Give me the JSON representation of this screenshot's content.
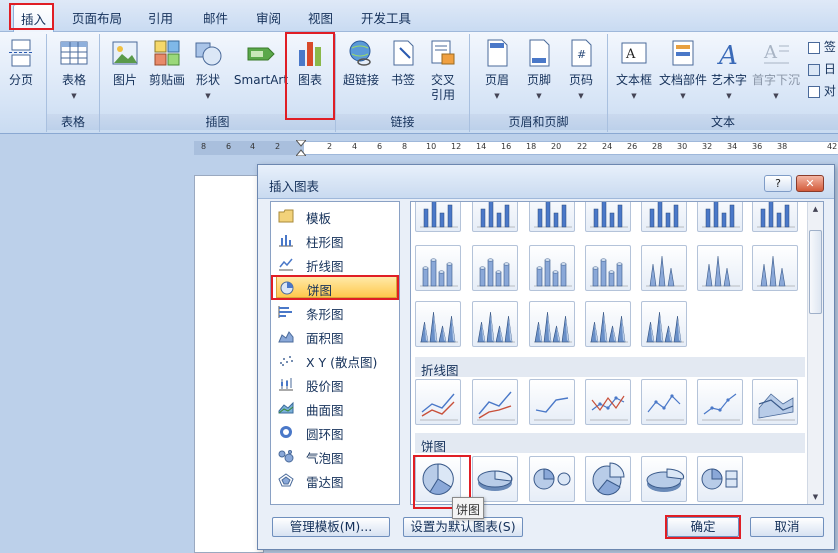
{
  "ribbon": {
    "tabs": [
      "插入",
      "页面布局",
      "引用",
      "邮件",
      "审阅",
      "视图",
      "开发工具"
    ],
    "buttons": {
      "pagebreak": "分页",
      "table": "表格",
      "picture": "图片",
      "clipart": "剪贴画",
      "shapes": "形状",
      "smartart": "SmartArt",
      "chart": "图表",
      "hyperlink": "超链接",
      "bookmark": "书签",
      "crossref_1": "交叉",
      "crossref_2": "引用",
      "header": "页眉",
      "footer": "页脚",
      "pagenumber": "页码",
      "textbox": "文本框",
      "quickparts": "文档部件",
      "wordart": "艺术字",
      "dropcap": "首字下沉",
      "signature": "签",
      "datetime": "日",
      "object": "对"
    },
    "groups": {
      "tables": "表格",
      "illustrations": "插图",
      "links": "链接",
      "header_footer": "页眉和页脚",
      "text": "文本"
    }
  },
  "ruler": {
    "ticks": [
      "8",
      "6",
      "4",
      "2",
      "2",
      "4",
      "6",
      "8",
      "10",
      "12",
      "14",
      "16",
      "18",
      "20",
      "22",
      "24",
      "26",
      "28",
      "30",
      "32",
      "34",
      "36",
      "38",
      "42"
    ]
  },
  "dialog": {
    "title": "插入图表",
    "help_label": "?",
    "close_label": "✕",
    "categories": [
      "模板",
      "柱形图",
      "折线图",
      "饼图",
      "条形图",
      "面积图",
      "X Y (散点图)",
      "股价图",
      "曲面图",
      "圆环图",
      "气泡图",
      "雷达图"
    ],
    "selected_category": "饼图",
    "sections": {
      "line": "折线图",
      "pie": "饼图"
    },
    "tooltip": "饼图",
    "buttons": {
      "manage_templates": "管理模板(M)...",
      "set_default": "设置为默认图表(S)",
      "ok": "确定",
      "cancel": "取消"
    }
  },
  "colors": {
    "highlight_red": "#e01e25",
    "selection_orange": "#ffc94d",
    "ribbon_blue": "#c9dbf2"
  }
}
